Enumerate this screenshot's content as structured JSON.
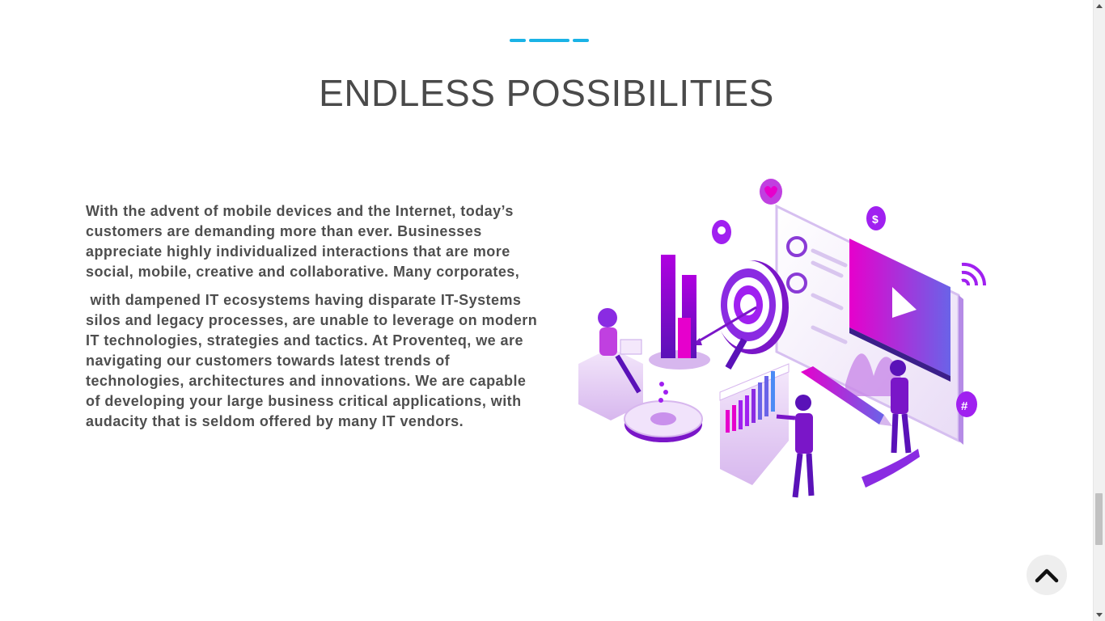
{
  "section": {
    "title": "ENDLESS POSSIBILITIES",
    "paragraphs": [
      "With the advent of mobile devices and the Internet, today’s customers are demanding more than ever. Businesses appreciate highly individualized interactions that are more social, mobile, creative and collaborative. Many corporates,",
      " with dampened IT ecosystems having disparate IT-Systems silos and legacy processes, are unable to leverage on modern IT technologies, strategies and tactics. At Proventeq, we are navigating our customers towards latest trends of technologies, architectures and innovations. We are capable of developing your large business critical applications, with audacity that is seldom offered by many IT vendors."
    ]
  },
  "illustration": {
    "icons": [
      "target-icon",
      "play-icon",
      "dollar-icon",
      "heart-icon",
      "wifi-icon",
      "hashtag-icon",
      "gear-icon",
      "bar-chart-icon"
    ]
  },
  "colors": {
    "accent": "#1ab3e6",
    "heading": "#4a4a4a",
    "body": "#4e4e4e",
    "magenta": "#e600cc",
    "purple": "#7a16c8"
  },
  "controls": {
    "back_to_top_icon": "chevron-up-icon"
  }
}
